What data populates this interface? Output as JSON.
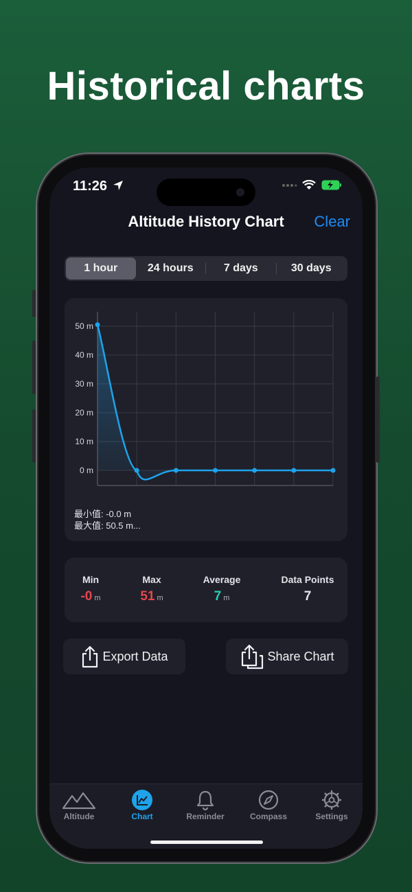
{
  "headline": "Historical charts",
  "status": {
    "time": "11:26"
  },
  "nav": {
    "title": "Altitude History Chart",
    "clear_label": "Clear"
  },
  "segments": [
    {
      "label": "1 hour",
      "selected": true
    },
    {
      "label": "24 hours",
      "selected": false
    },
    {
      "label": "7 days",
      "selected": false
    },
    {
      "label": "30 days",
      "selected": false
    }
  ],
  "chart_data": {
    "type": "line",
    "title": "",
    "xlabel": "",
    "ylabel": "",
    "x": [
      0,
      1,
      2,
      3,
      4,
      5,
      6
    ],
    "series": [
      {
        "values": [
          50.5,
          0,
          0,
          0,
          0,
          0,
          0
        ]
      }
    ],
    "ylim": [
      -5,
      55
    ],
    "yticks": [
      "0 m",
      "10 m",
      "20 m",
      "30 m",
      "40 m",
      "50 m"
    ],
    "ytick_values": [
      0,
      10,
      20,
      30,
      40,
      50
    ],
    "grid": true,
    "color": "#1ea3ea",
    "annotations": [
      "最小值: -0.0 m",
      "最大值: 50.5 m..."
    ]
  },
  "stats": {
    "min": {
      "label": "Min",
      "value": "-0",
      "unit": "m",
      "color": "#e5484d"
    },
    "max": {
      "label": "Max",
      "value": "51",
      "unit": "m",
      "color": "#e5484d"
    },
    "average": {
      "label": "Average",
      "value": "7",
      "unit": "m",
      "color": "#2ad0b4"
    },
    "data_points": {
      "label": "Data Points",
      "value": "7"
    }
  },
  "actions": {
    "export_label": "Export Data",
    "share_label": "Share Chart"
  },
  "tabs": [
    {
      "label": "Altitude",
      "icon": "mountain-icon",
      "active": false
    },
    {
      "label": "Chart",
      "icon": "chart-icon",
      "active": true
    },
    {
      "label": "Reminder",
      "icon": "bell-icon",
      "active": false
    },
    {
      "label": "Compass",
      "icon": "compass-icon",
      "active": false
    },
    {
      "label": "Settings",
      "icon": "gear-icon",
      "active": false
    }
  ]
}
